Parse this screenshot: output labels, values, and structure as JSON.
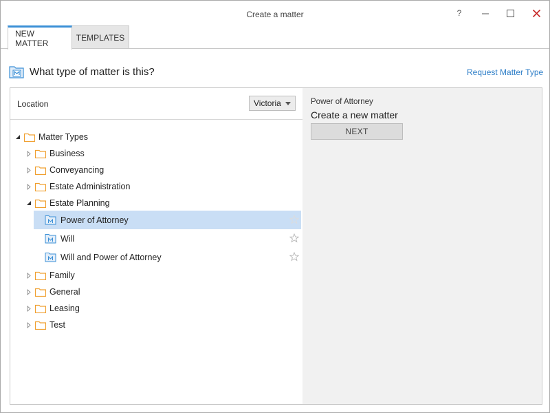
{
  "window": {
    "title": "Create a matter",
    "help_label": "?",
    "minimize_label": "–",
    "maximize_label": "☐",
    "close_label": "✕",
    "accent_color": "#3a8fd6",
    "close_color": "#c41e1e"
  },
  "tabs": [
    {
      "label": "NEW MATTER",
      "active": true
    },
    {
      "label": "TEMPLATES",
      "active": false
    }
  ],
  "heading": {
    "icon": "matter-icon",
    "text": "What type of matter is this?",
    "link_label": "Request Matter Type"
  },
  "location": {
    "label": "Location",
    "selected": "Victoria"
  },
  "tree": {
    "root": {
      "label": "Matter Types",
      "expanded": true
    },
    "folders": [
      {
        "label": "Business",
        "expanded": false
      },
      {
        "label": "Conveyancing",
        "expanded": false
      },
      {
        "label": "Estate Administration",
        "expanded": false
      },
      {
        "label": "Estate Planning",
        "expanded": true
      },
      {
        "label": "Family",
        "expanded": false
      },
      {
        "label": "General",
        "expanded": false
      },
      {
        "label": "Leasing",
        "expanded": false
      },
      {
        "label": "Test",
        "expanded": false
      }
    ],
    "estate_planning_items": [
      {
        "label": "Power of Attorney",
        "selected": true
      },
      {
        "label": "Will",
        "selected": false
      },
      {
        "label": "Will and Power of Attorney",
        "selected": false
      }
    ]
  },
  "detail": {
    "subtitle": "Power of Attorney",
    "title": "Create a new matter",
    "next_label": "NEXT"
  }
}
